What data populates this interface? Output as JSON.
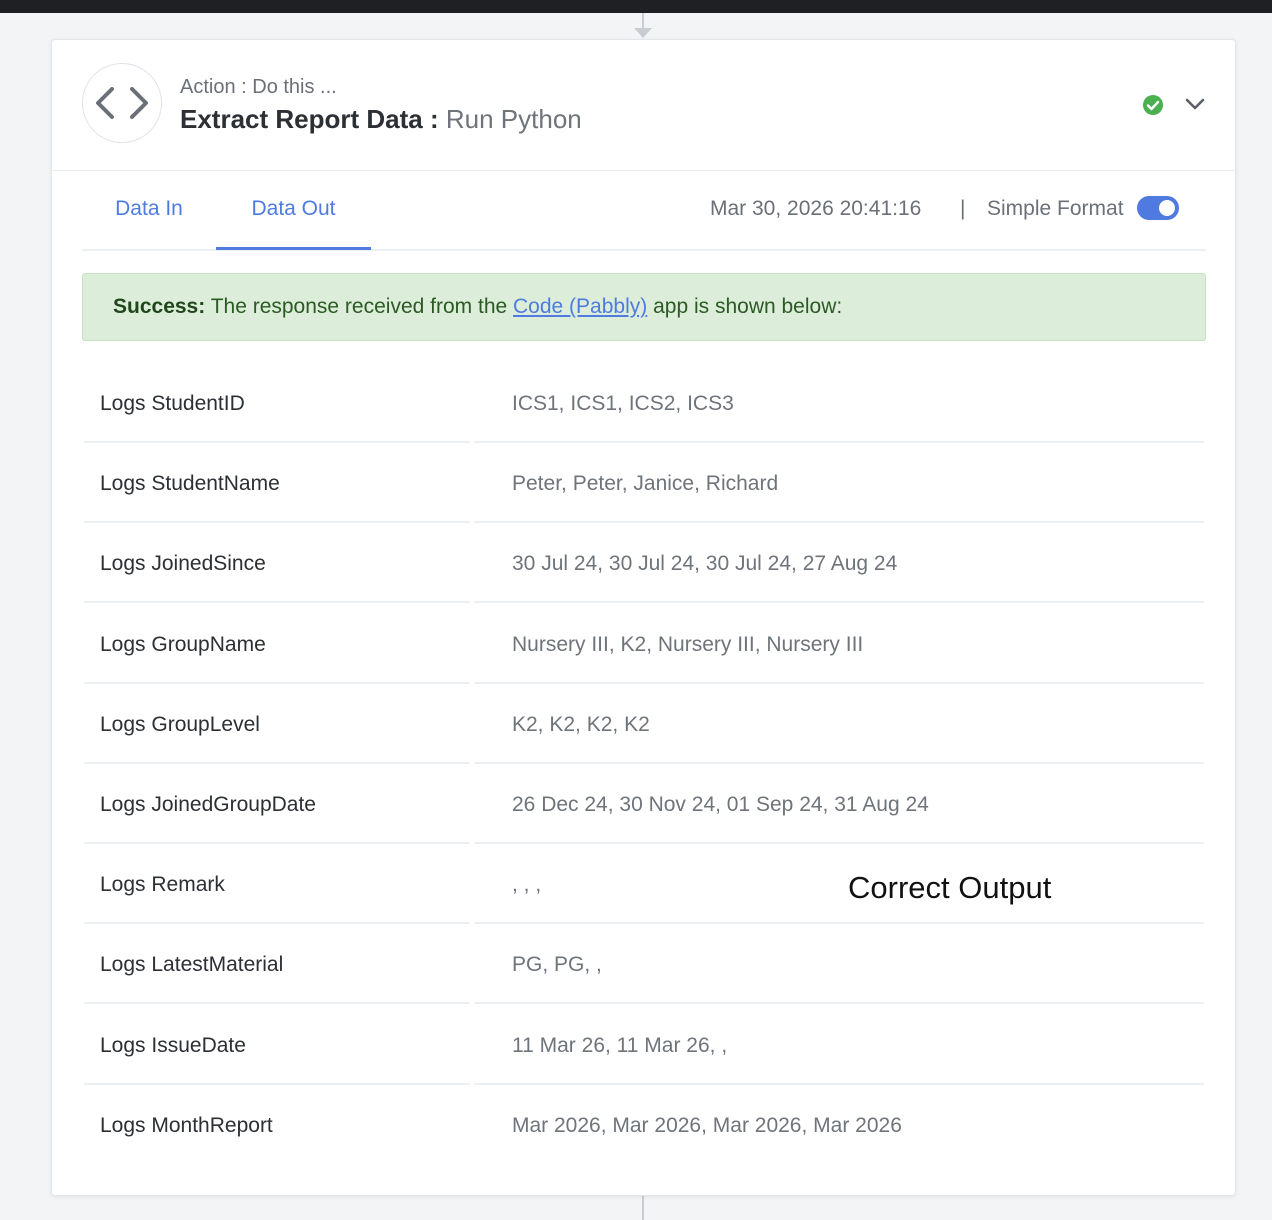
{
  "step": {
    "label": "Action : Do this ...",
    "title": "Extract Report Data",
    "separator": ":",
    "app_name": "Run Python"
  },
  "tabs": [
    {
      "label": "Data In",
      "active": false
    },
    {
      "label": "Data Out",
      "active": true
    }
  ],
  "meta": {
    "timestamp": "Mar 30, 2026 20:41:16",
    "divider": "|",
    "format_label": "Simple Format",
    "simple_format_enabled": true
  },
  "alert": {
    "prefix": "Success:",
    "text_before": " The response received from the ",
    "link_text": "Code (Pabbly)",
    "text_after": " app is shown below:"
  },
  "rows": [
    {
      "key": "Logs StudentID",
      "value": "ICS1, ICS1, ICS2, ICS3"
    },
    {
      "key": "Logs StudentName",
      "value": "Peter, Peter, Janice, Richard"
    },
    {
      "key": "Logs JoinedSince",
      "value": "30 Jul 24, 30 Jul 24, 30 Jul 24, 27 Aug 24"
    },
    {
      "key": "Logs GroupName",
      "value": "Nursery III, K2, Nursery III, Nursery III"
    },
    {
      "key": "Logs GroupLevel",
      "value": "K2, K2, K2, K2"
    },
    {
      "key": "Logs JoinedGroupDate",
      "value": "26 Dec 24, 30 Nov 24, 01 Sep 24, 31 Aug 24"
    },
    {
      "key": "Logs Remark",
      "value": ", , ,"
    },
    {
      "key": "Logs LatestMaterial",
      "value": "PG, PG, ,"
    },
    {
      "key": "Logs IssueDate",
      "value": "11 Mar 26, 11 Mar 26, ,"
    },
    {
      "key": "Logs MonthReport",
      "value": "Mar 2026, Mar 2026, Mar 2026, Mar 2026"
    }
  ],
  "annotation": "Correct Output",
  "colors": {
    "accent": "#4f7be0",
    "success_bg": "#dcedd9",
    "success_icon": "#4caf50"
  }
}
